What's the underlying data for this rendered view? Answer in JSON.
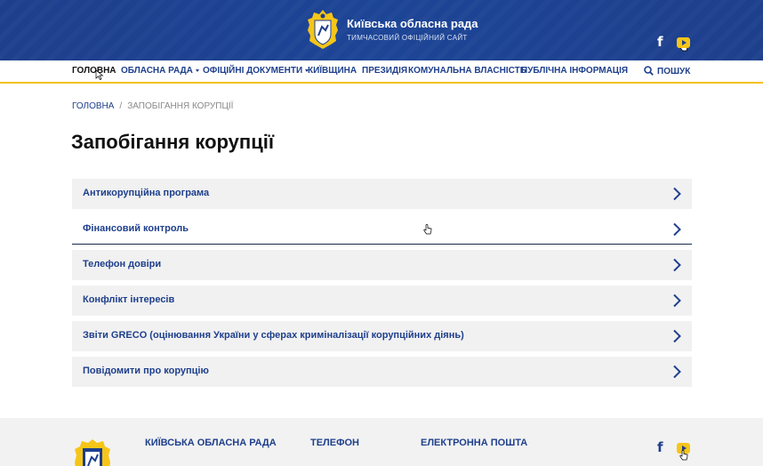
{
  "header": {
    "title": "Київська обласна рада",
    "subtitle": "ТИМЧАСОВИЙ ОФІЦІЙНИЙ САЙТ",
    "facebook_glyph": "f",
    "youtube_icon": "youtube-icon"
  },
  "nav": {
    "items": [
      {
        "label": "ГОЛОВНА",
        "dropdown": false,
        "active": true
      },
      {
        "label": "ОБЛАСНА РАДА",
        "dropdown": true
      },
      {
        "label": "ОФІЦІЙНІ ДОКУМЕНТИ",
        "dropdown": true
      },
      {
        "label": "КИЇВЩИНА",
        "dropdown": false
      },
      {
        "label": "ПРЕЗИДІЯ",
        "dropdown": false
      },
      {
        "label": "КОМУНАЛЬНА ВЛАСНІСТЬ",
        "dropdown": false
      },
      {
        "label": "ПУБЛІЧНА ІНФОРМАЦІЯ",
        "dropdown": false
      }
    ],
    "search_label": "ПОШУК"
  },
  "breadcrumb": {
    "home": "ГОЛОВНА",
    "separator": "/",
    "current": "ЗАПОБІГАННЯ КОРУПЦІЇ"
  },
  "page": {
    "title": "Запобігання корупції"
  },
  "items": [
    {
      "label": "Антикорупційна програма"
    },
    {
      "label": "Фінансовий контроль"
    },
    {
      "label": "Телефон довіри"
    },
    {
      "label": "Конфлікт інтересів"
    },
    {
      "label": "Звіти GRECO (оцінювання України у сферах криміналізації корупційних діянь)"
    },
    {
      "label": "Повідомити про корупцію"
    }
  ],
  "footer": {
    "columns": [
      {
        "heading": "КИЇВСЬКА ОБЛАСНА РАДА"
      },
      {
        "heading": "ТЕЛЕФОН"
      },
      {
        "heading": "ЕЛЕКТРОННА ПОШТА"
      }
    ],
    "facebook_glyph": "f"
  },
  "colors": {
    "brand_blue": "#1e3f8c",
    "accent_yellow": "#f2c21a",
    "item_bg": "#f1f1f1"
  }
}
